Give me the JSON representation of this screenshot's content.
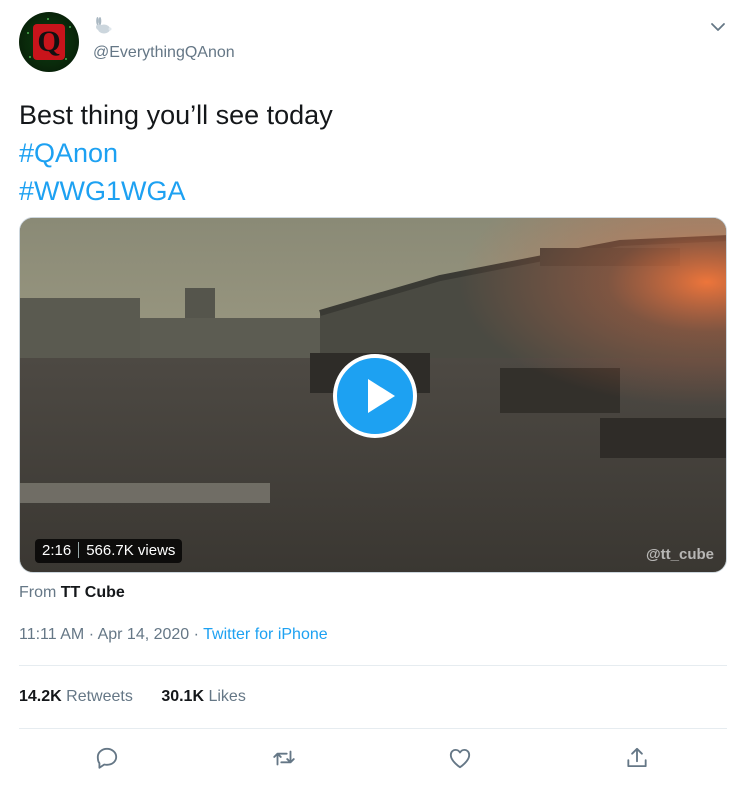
{
  "author": {
    "display_name_icon": "rabbit-emoji",
    "handle": "@EverythingQAnon",
    "avatar_letter": "Q"
  },
  "tweet": {
    "text": "Best thing you’ll see today",
    "hashtags": [
      "#QAnon",
      "#WWG1WGA"
    ]
  },
  "media": {
    "duration": "2:16",
    "views": "566.7K views",
    "watermark": "@tt_cube"
  },
  "source": {
    "prefix": "From",
    "name": "TT Cube"
  },
  "meta": {
    "time": "11:11 AM",
    "date": "Apr 14, 2020",
    "app": "Twitter for iPhone"
  },
  "stats": {
    "retweets_count": "14.2K",
    "retweets_label": "Retweets",
    "likes_count": "30.1K",
    "likes_label": "Likes"
  },
  "colors": {
    "accent": "#1da1f2",
    "secondary_text": "#657786",
    "primary_text": "#14171a"
  },
  "actions": [
    "reply-icon",
    "retweet-icon",
    "like-icon",
    "share-icon"
  ]
}
